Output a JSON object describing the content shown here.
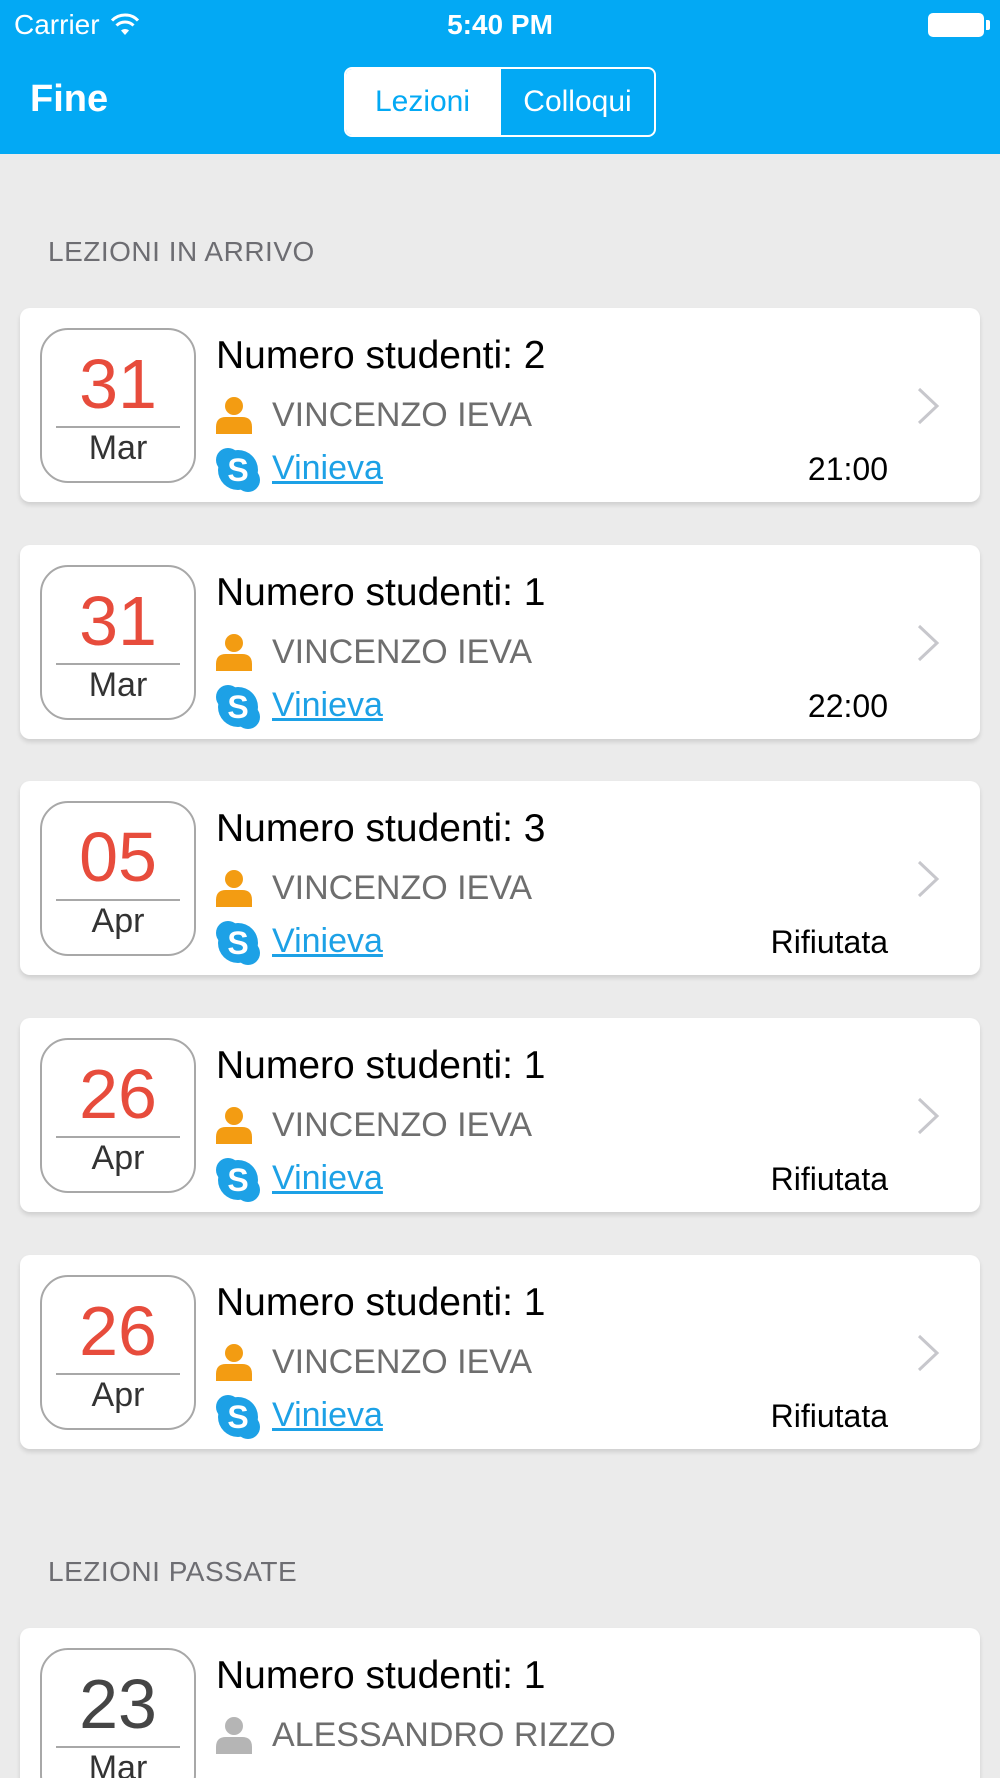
{
  "status_bar": {
    "carrier": "Carrier",
    "time": "5:40 PM"
  },
  "nav": {
    "done_label": "Fine",
    "segments": [
      {
        "label": "Lezioni",
        "active": true
      },
      {
        "label": "Colloqui",
        "active": false
      }
    ]
  },
  "colors": {
    "accent": "#03a9f4",
    "date_red": "#e74c3c",
    "person_orange": "#f39c12",
    "link_blue": "#1da1e6"
  },
  "sections": {
    "upcoming": {
      "header": "LEZIONI IN ARRIVO",
      "items": [
        {
          "day": "31",
          "month": "Mar",
          "title": "Numero studenti: 2",
          "person": "VINCENZO IEVA",
          "skype": "Vinieva",
          "status": "21:00"
        },
        {
          "day": "31",
          "month": "Mar",
          "title": "Numero studenti: 1",
          "person": "VINCENZO IEVA",
          "skype": "Vinieva",
          "status": "22:00"
        },
        {
          "day": "05",
          "month": "Apr",
          "title": "Numero studenti: 3",
          "person": "VINCENZO IEVA",
          "skype": "Vinieva",
          "status": "Rifiutata"
        },
        {
          "day": "26",
          "month": "Apr",
          "title": "Numero studenti: 1",
          "person": "VINCENZO IEVA",
          "skype": "Vinieva",
          "status": "Rifiutata"
        },
        {
          "day": "26",
          "month": "Apr",
          "title": "Numero studenti: 1",
          "person": "VINCENZO IEVA",
          "skype": "Vinieva",
          "status": "Rifiutata"
        }
      ]
    },
    "past": {
      "header": "LEZIONI PASSATE",
      "items": [
        {
          "day": "23",
          "month": "Mar",
          "title": "Numero studenti: 1",
          "person": "ALESSANDRO RIZZO"
        }
      ]
    }
  }
}
